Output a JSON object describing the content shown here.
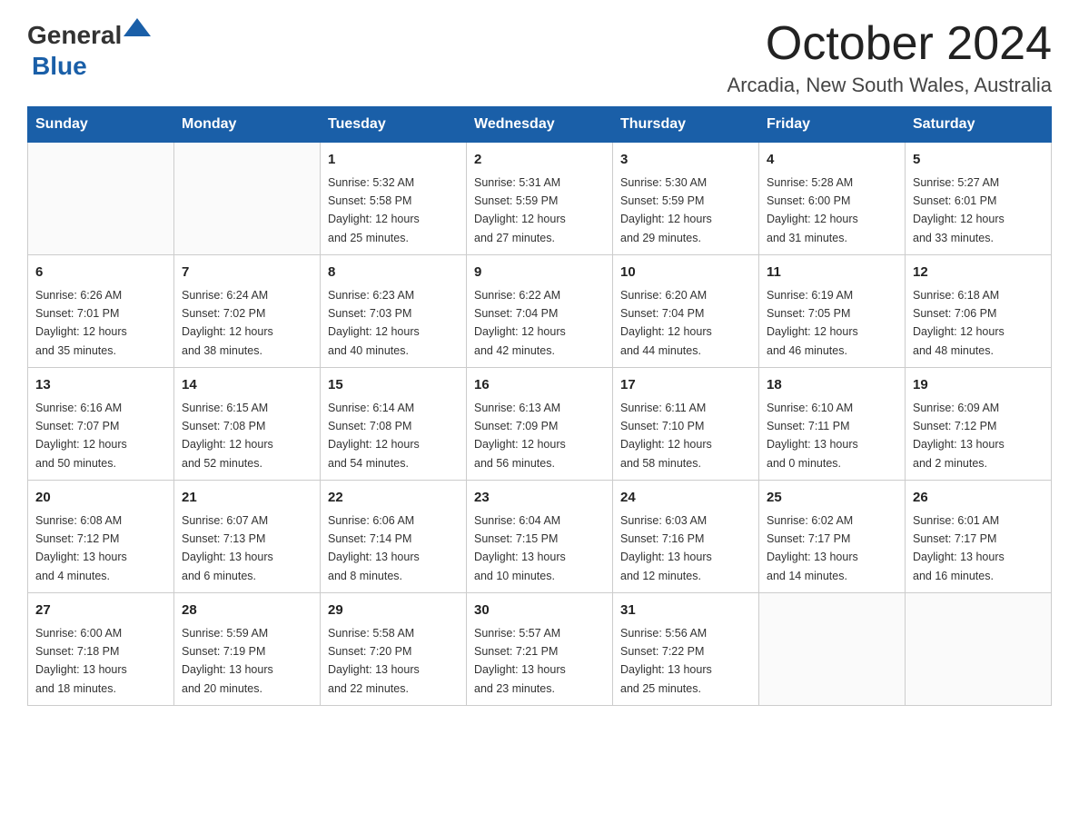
{
  "header": {
    "logo": {
      "general": "General",
      "blue": "Blue"
    },
    "title": "October 2024",
    "location": "Arcadia, New South Wales, Australia"
  },
  "weekdays": [
    "Sunday",
    "Monday",
    "Tuesday",
    "Wednesday",
    "Thursday",
    "Friday",
    "Saturday"
  ],
  "weeks": [
    [
      {
        "day": "",
        "info": ""
      },
      {
        "day": "",
        "info": ""
      },
      {
        "day": "1",
        "info": "Sunrise: 5:32 AM\nSunset: 5:58 PM\nDaylight: 12 hours\nand 25 minutes."
      },
      {
        "day": "2",
        "info": "Sunrise: 5:31 AM\nSunset: 5:59 PM\nDaylight: 12 hours\nand 27 minutes."
      },
      {
        "day": "3",
        "info": "Sunrise: 5:30 AM\nSunset: 5:59 PM\nDaylight: 12 hours\nand 29 minutes."
      },
      {
        "day": "4",
        "info": "Sunrise: 5:28 AM\nSunset: 6:00 PM\nDaylight: 12 hours\nand 31 minutes."
      },
      {
        "day": "5",
        "info": "Sunrise: 5:27 AM\nSunset: 6:01 PM\nDaylight: 12 hours\nand 33 minutes."
      }
    ],
    [
      {
        "day": "6",
        "info": "Sunrise: 6:26 AM\nSunset: 7:01 PM\nDaylight: 12 hours\nand 35 minutes."
      },
      {
        "day": "7",
        "info": "Sunrise: 6:24 AM\nSunset: 7:02 PM\nDaylight: 12 hours\nand 38 minutes."
      },
      {
        "day": "8",
        "info": "Sunrise: 6:23 AM\nSunset: 7:03 PM\nDaylight: 12 hours\nand 40 minutes."
      },
      {
        "day": "9",
        "info": "Sunrise: 6:22 AM\nSunset: 7:04 PM\nDaylight: 12 hours\nand 42 minutes."
      },
      {
        "day": "10",
        "info": "Sunrise: 6:20 AM\nSunset: 7:04 PM\nDaylight: 12 hours\nand 44 minutes."
      },
      {
        "day": "11",
        "info": "Sunrise: 6:19 AM\nSunset: 7:05 PM\nDaylight: 12 hours\nand 46 minutes."
      },
      {
        "day": "12",
        "info": "Sunrise: 6:18 AM\nSunset: 7:06 PM\nDaylight: 12 hours\nand 48 minutes."
      }
    ],
    [
      {
        "day": "13",
        "info": "Sunrise: 6:16 AM\nSunset: 7:07 PM\nDaylight: 12 hours\nand 50 minutes."
      },
      {
        "day": "14",
        "info": "Sunrise: 6:15 AM\nSunset: 7:08 PM\nDaylight: 12 hours\nand 52 minutes."
      },
      {
        "day": "15",
        "info": "Sunrise: 6:14 AM\nSunset: 7:08 PM\nDaylight: 12 hours\nand 54 minutes."
      },
      {
        "day": "16",
        "info": "Sunrise: 6:13 AM\nSunset: 7:09 PM\nDaylight: 12 hours\nand 56 minutes."
      },
      {
        "day": "17",
        "info": "Sunrise: 6:11 AM\nSunset: 7:10 PM\nDaylight: 12 hours\nand 58 minutes."
      },
      {
        "day": "18",
        "info": "Sunrise: 6:10 AM\nSunset: 7:11 PM\nDaylight: 13 hours\nand 0 minutes."
      },
      {
        "day": "19",
        "info": "Sunrise: 6:09 AM\nSunset: 7:12 PM\nDaylight: 13 hours\nand 2 minutes."
      }
    ],
    [
      {
        "day": "20",
        "info": "Sunrise: 6:08 AM\nSunset: 7:12 PM\nDaylight: 13 hours\nand 4 minutes."
      },
      {
        "day": "21",
        "info": "Sunrise: 6:07 AM\nSunset: 7:13 PM\nDaylight: 13 hours\nand 6 minutes."
      },
      {
        "day": "22",
        "info": "Sunrise: 6:06 AM\nSunset: 7:14 PM\nDaylight: 13 hours\nand 8 minutes."
      },
      {
        "day": "23",
        "info": "Sunrise: 6:04 AM\nSunset: 7:15 PM\nDaylight: 13 hours\nand 10 minutes."
      },
      {
        "day": "24",
        "info": "Sunrise: 6:03 AM\nSunset: 7:16 PM\nDaylight: 13 hours\nand 12 minutes."
      },
      {
        "day": "25",
        "info": "Sunrise: 6:02 AM\nSunset: 7:17 PM\nDaylight: 13 hours\nand 14 minutes."
      },
      {
        "day": "26",
        "info": "Sunrise: 6:01 AM\nSunset: 7:17 PM\nDaylight: 13 hours\nand 16 minutes."
      }
    ],
    [
      {
        "day": "27",
        "info": "Sunrise: 6:00 AM\nSunset: 7:18 PM\nDaylight: 13 hours\nand 18 minutes."
      },
      {
        "day": "28",
        "info": "Sunrise: 5:59 AM\nSunset: 7:19 PM\nDaylight: 13 hours\nand 20 minutes."
      },
      {
        "day": "29",
        "info": "Sunrise: 5:58 AM\nSunset: 7:20 PM\nDaylight: 13 hours\nand 22 minutes."
      },
      {
        "day": "30",
        "info": "Sunrise: 5:57 AM\nSunset: 7:21 PM\nDaylight: 13 hours\nand 23 minutes."
      },
      {
        "day": "31",
        "info": "Sunrise: 5:56 AM\nSunset: 7:22 PM\nDaylight: 13 hours\nand 25 minutes."
      },
      {
        "day": "",
        "info": ""
      },
      {
        "day": "",
        "info": ""
      }
    ]
  ]
}
